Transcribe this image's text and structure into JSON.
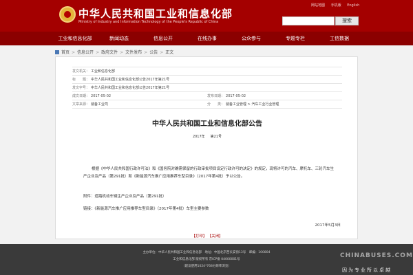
{
  "header": {
    "title_cn": "中华人民共和国工业和信息化部",
    "title_en": "Ministry of Industry and Information Technology of the People's Republic of China",
    "top_links": [
      "网站地图",
      "手机版",
      "English"
    ],
    "search_button": "搜索",
    "search_placeholder": ""
  },
  "nav": {
    "items": [
      "工业和信息化部",
      "新闻动态",
      "信息公开",
      "在线办事",
      "公众参与",
      "专题专栏",
      "工信数据"
    ]
  },
  "breadcrumb": [
    "首页",
    "信息公开",
    "政府文件",
    "文件发布",
    "公告",
    "正文"
  ],
  "meta": {
    "issuer_label": "发文机关：",
    "issuer": "工业和信息化部",
    "title_label": "标　　题：",
    "title": "中华人民共和国工业和信息化部公告2017年第21号",
    "docno_label": "发文字号：",
    "docno": "中华人民共和国工业和信息化部公告2017年第21号",
    "created_label": "成文日期：",
    "created": "2017-05-02",
    "published_label": "发布日期：",
    "published": "2017-05-02",
    "category_label": "文章来源：",
    "category": "装备工业司",
    "topic_label": "分　　类：",
    "topic": "装备工业管理 > 汽车工业行业管理"
  },
  "document": {
    "title": "中华人民共和国工业和信息化部公告",
    "year": "2017年",
    "number": "第21号",
    "paragraph1": "根据《中华人民共和国行政许可法》和《国务院对确需保留的行政审批项目设定行政许可的决定》的规定，现将许可的汽车、摩托车、三轮汽车生产企业及产品（第291批）和《新能源汽车推广应用推荐车型目录》（2017年第4批）予以公告。",
    "attachment_label": "附件：",
    "attachment": "道路机动车辆生产企业及产品（第291批）",
    "link_label": "链接：",
    "link": "《新能源汽车推广应用推荐车型目录》（2017年第4批）车型主要参数",
    "date": "2017年5月3日",
    "print": "【打印】",
    "close": "【关闭】"
  },
  "footer": {
    "line1": "主办单位：中华人民共和国工业和信息化部　地址：中国北京西长安街13号　邮编：100804",
    "line2": "工业和信息化部 版权所有 京ICP备 04000001号",
    "line3": "（建议使用1024*768分辨率浏览）"
  },
  "watermark": {
    "logo": "CHINABUSES.COM",
    "slogan": "因为专业所以卓越"
  }
}
